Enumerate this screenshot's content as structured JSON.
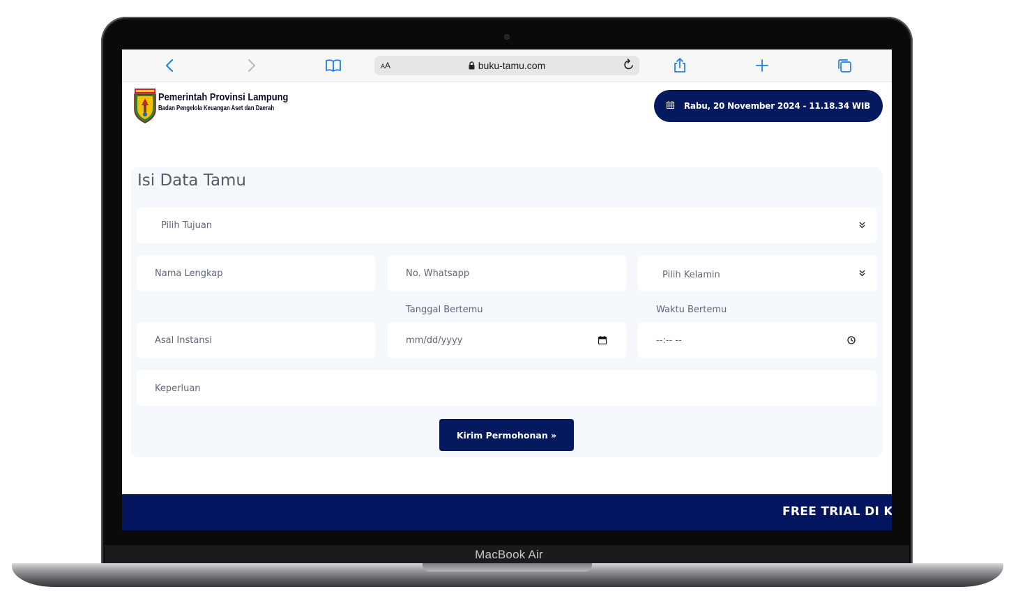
{
  "device": {
    "model_label": "MacBook Air"
  },
  "browser": {
    "text_size_label_large": "A",
    "text_size_label_small": "A",
    "url": "buku-tamu.com",
    "back_icon": "chevron-left-icon",
    "forward_icon": "chevron-right-icon",
    "bookmarks_icon": "book-icon",
    "reload_icon": "reload-icon",
    "share_icon": "share-icon",
    "new_tab_icon": "plus-icon",
    "tabs_icon": "tabs-icon"
  },
  "header": {
    "org_name": "Pemerintah Provinsi Lampung",
    "org_sub": "Badan Pengelola Keuangan Aset dan Daerah",
    "datetime": "Rabu, 20 November 2024 - 11.18.34 WIB",
    "datetime_icon": "calendar-icon"
  },
  "form": {
    "title": "Isi Data Tamu",
    "tujuan_placeholder": "Pilih Tujuan",
    "nama_placeholder": "Nama Lengkap",
    "whatsapp_placeholder": "No. Whatsapp",
    "kelamin_placeholder": "Pilih Kelamin",
    "tanggal_label": "Tanggal Bertemu",
    "waktu_label": "Waktu Bertemu",
    "instansi_placeholder": "Asal Instansi",
    "tanggal_placeholder": "mm/dd/yyyy",
    "waktu_placeholder": "--:-- --",
    "keperluan_placeholder": "Keperluan",
    "submit_label": "Kirim Permohonan »"
  },
  "marquee": {
    "text": "FREE TRIAL DI KANTOR"
  },
  "colors": {
    "primary": "#051a5e",
    "marquee_bg": "#041560",
    "card_bg": "#f5f8fc",
    "browser_accent": "#1a7cf0"
  }
}
